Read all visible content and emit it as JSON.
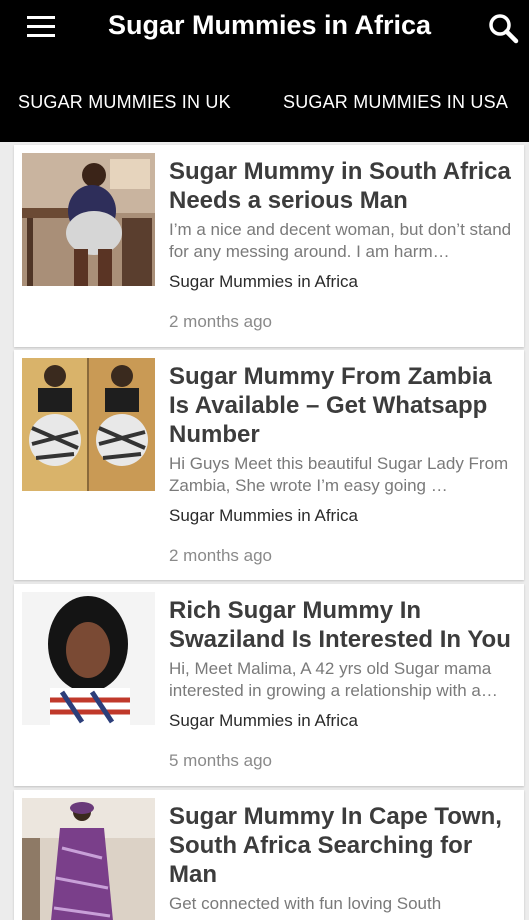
{
  "app": {
    "title": "Sugar Mummies in Africa"
  },
  "tabs": [
    {
      "label": "SUGAR MUMMIES IN UK"
    },
    {
      "label": "SUGAR MUMMIES IN USA"
    }
  ],
  "posts": [
    {
      "title": "Sugar Mummy in South Africa Needs a serious Man",
      "excerpt": "I’m a nice and decent woman, but don’t stand for any messing around. I am harm…",
      "category": "Sugar Mummies in Africa",
      "time": "2 months ago"
    },
    {
      "title": "Sugar Mummy From Zambia Is Available – Get Whatsapp Number",
      "excerpt": "Hi Guys Meet this beautiful Sugar Lady From Zambia, She wrote  I’m easy going …",
      "category": "Sugar Mummies in Africa",
      "time": "2 months ago"
    },
    {
      "title": "Rich Sugar Mummy In Swaziland Is Interested In You",
      "excerpt": "Hi, Meet Malima, A 42 yrs old Sugar mama interested in growing a relationship with a…",
      "category": "Sugar Mummies in Africa",
      "time": "5 months ago"
    },
    {
      "title": "Sugar Mummy In Cape Town, South Africa Searching for Man",
      "excerpt": "Get connected with fun loving South",
      "category": "",
      "time": ""
    }
  ]
}
